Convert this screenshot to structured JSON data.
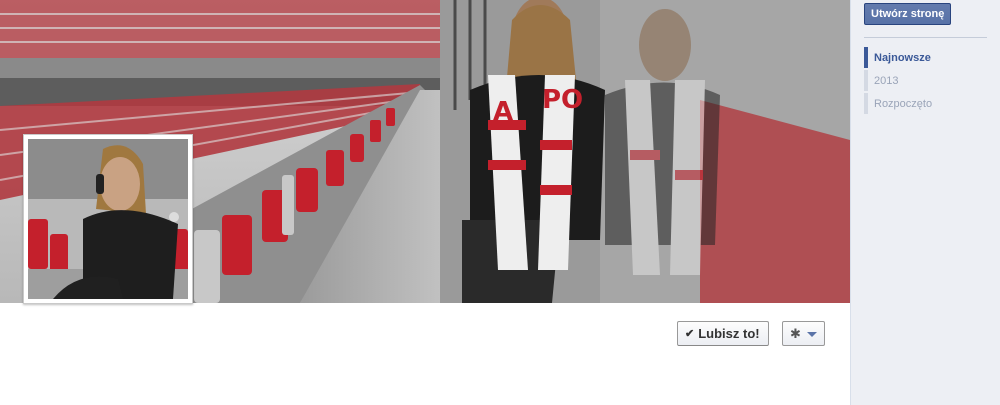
{
  "cover": {
    "image": "stadium-cover-photo",
    "scarf_text": "PO"
  },
  "profile": {
    "image": "profile-photo"
  },
  "actions": {
    "like_label": "Lubisz to!",
    "like_icon": "check-icon",
    "settings_icon": "gear-icon"
  },
  "sidebar": {
    "create_page_label": "Utwórz stronę",
    "timeline": [
      {
        "label": "Najnowsze",
        "active": true
      },
      {
        "label": "2013",
        "active": false
      },
      {
        "label": "Rozpoczęto",
        "active": false
      }
    ]
  },
  "colors": {
    "brand": "#3b5998",
    "sidebar_bg": "#edeff4",
    "seat_red": "#c4202c"
  }
}
